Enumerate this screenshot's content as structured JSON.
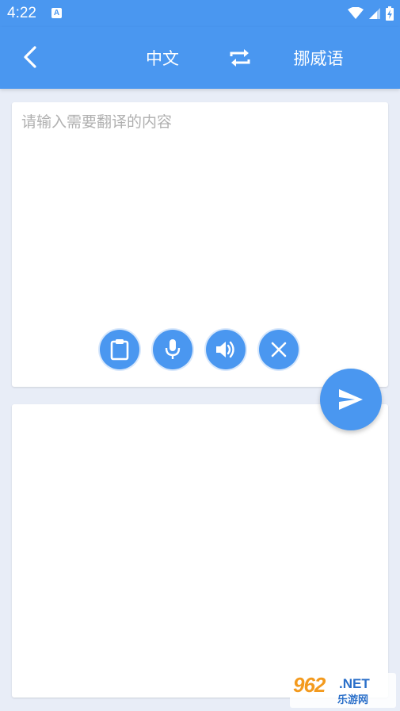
{
  "status_bar": {
    "time": "4:22",
    "notification_icon_letter": "A",
    "icons": [
      "wifi-icon",
      "signal-icon",
      "battery-charging-icon"
    ]
  },
  "app_bar": {
    "back_icon": "chevron-left-icon",
    "source_language": "中文",
    "swap_icon": "swap-arrows-icon",
    "target_language": "挪威语"
  },
  "input": {
    "placeholder": "请输入需要翻译的内容",
    "value": ""
  },
  "toolbar": {
    "buttons": [
      {
        "name": "paste",
        "icon": "clipboard-icon"
      },
      {
        "name": "voice-input",
        "icon": "microphone-icon"
      },
      {
        "name": "speak",
        "icon": "speaker-icon"
      },
      {
        "name": "clear",
        "icon": "close-icon"
      }
    ]
  },
  "translate_button": {
    "icon": "send-icon"
  },
  "output": {
    "text": ""
  },
  "watermark": {
    "number": "962",
    "domain": ".NET",
    "label": "乐游网"
  },
  "colors": {
    "primary": "#4a97f0",
    "background": "#e8edf7",
    "card": "#ffffff",
    "placeholder": "#b0b0b0"
  }
}
